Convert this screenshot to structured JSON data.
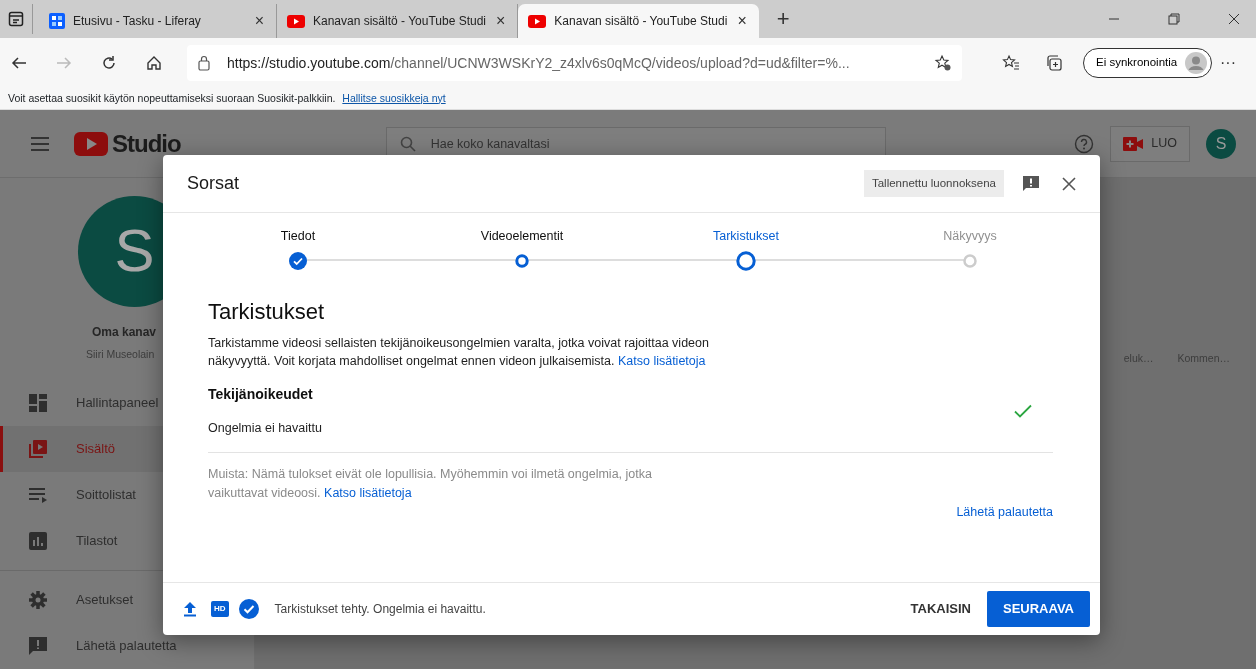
{
  "browser": {
    "tabs": [
      {
        "title": "Etusivu - Tasku - Liferay",
        "kind": "grid",
        "selected": false,
        "close": "×"
      },
      {
        "title": "Kanavan sisältö - YouTube Studi",
        "kind": "play",
        "selected": false,
        "close": "×"
      },
      {
        "title": "Kanavan sisältö - YouTube Studi",
        "kind": "play",
        "selected": true,
        "close": "×"
      }
    ],
    "new_tab": "+",
    "url_host": "https://studio.youtube.com",
    "url_path": "/channel/UCNW3WSKrY2_z4xlv6s0qMcQ/videos/upload?d=ud&filter=%...",
    "sync_button": "Ei synkronointia",
    "more": "···",
    "favorites_bar": {
      "message": "Voit asettaa suosikit käytön nopeuttamiseksi suoraan Suosikit-palkkiin.",
      "link": "Hallitse suosikkeja nyt"
    }
  },
  "studio": {
    "logo_text": "Studio",
    "search_placeholder": "Hae koko kanavaltasi",
    "create_button": "LUO",
    "avatar_letter": "S",
    "channel": {
      "avatar_letter": "S",
      "name": "Oma kanav",
      "owner": "Siiri Museolain"
    },
    "nav": [
      {
        "label": "Hallintapaneel",
        "kind": "dashboard",
        "selected": false
      },
      {
        "label": "Sisältö",
        "kind": "content",
        "selected": true
      },
      {
        "label": "Soittolistat",
        "kind": "playlist",
        "selected": false
      },
      {
        "label": "Tilastot",
        "kind": "stats",
        "selected": false
      }
    ],
    "nav_bottom": [
      {
        "label": "Asetukset",
        "kind": "settings",
        "selected": false
      },
      {
        "label": "Lähetä palautetta",
        "kind": "feedback",
        "selected": false
      }
    ],
    "columns": [
      "eluk…",
      "Kommen…"
    ]
  },
  "dialog": {
    "title": "Sorsat",
    "saved_badge": "Tallennettu luonnoksena",
    "steps": [
      {
        "label": "Tiedot",
        "kind": "done",
        "selected": false
      },
      {
        "label": "Videoelementit",
        "kind": "visited",
        "selected": false
      },
      {
        "label": "Tarkistukset",
        "kind": "current",
        "selected": true
      },
      {
        "label": "Näkyvyys",
        "kind": "pending",
        "selected": false
      }
    ],
    "heading": "Tarkistukset",
    "intro": "Tarkistamme videosi sellaisten tekijänoikeusongelmien varalta, jotka voivat rajoittaa videon näkyvyyttä. Voit korjata mahdolliset ongelmat ennen videon julkaisemista.",
    "intro_link": "Katso lisätietoja",
    "checks": [
      {
        "title": "Tekijänoikeudet",
        "result": "Ongelmia ei havaittu",
        "passed": true
      }
    ],
    "note": "Muista: Nämä tulokset eivät ole lopullisia. Myöhemmin voi ilmetä ongelmia, jotka vaikuttavat videoosi.",
    "note_link": "Katso lisätietoja",
    "feedback_link": "Lähetä palautetta",
    "hd_badge": "HD",
    "footer_status": "Tarkistukset tehty. Ongelmia ei havaittu.",
    "back_button": "TAKAISIN",
    "next_button": "SEURAAVA"
  }
}
